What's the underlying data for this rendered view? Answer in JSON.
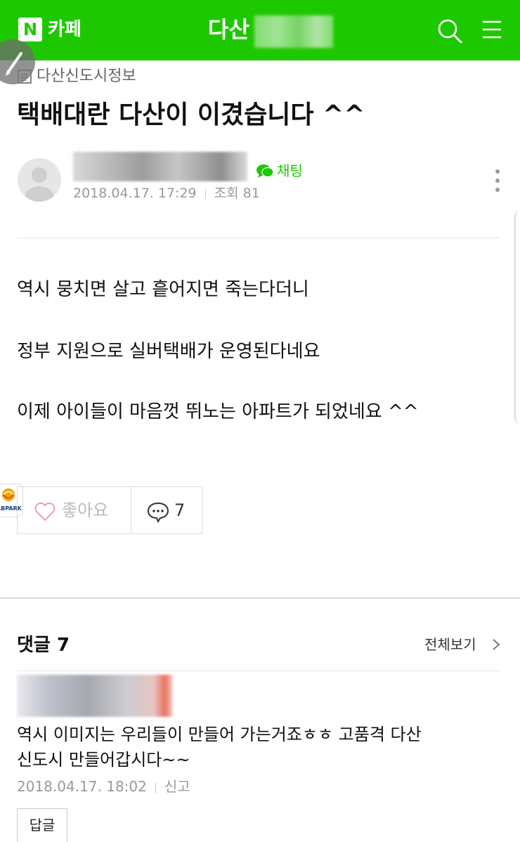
{
  "header": {
    "logo_letter": "N",
    "brand_label": "카페",
    "cafe_name_visible": "다산",
    "brand_color": "#1ec800"
  },
  "post": {
    "board_name": "다산신도시정보",
    "title": "택배대란 다산이 이겼습니다 ^^",
    "chat_label": "채팅",
    "date": "2018.04.17. 17:29",
    "views_label": "조회 81",
    "body": [
      "역시 뭉치면 살고 흩어지면 죽는다더니",
      "정부 지원으로 실버택배가 운영된다네요",
      "이제 아이들이 마음껏 뛰노는 아파트가 되었네요 ^^"
    ],
    "like_label": "좋아요",
    "comment_count": "7"
  },
  "ad_badge": {
    "text": "LBPARK"
  },
  "comments": {
    "title": "댓글 7",
    "view_all_label": "전체보기",
    "items": [
      {
        "text_lines": [
          "역시 이미지는 우리들이 만들어 가는거죠ㅎㅎ 고품격 다산",
          "신도시 만들어갑시다~~"
        ],
        "date": "2018.04.17. 18:02",
        "report_label": "신고",
        "reply_label": "답글"
      }
    ]
  },
  "icons": {
    "search": "search-icon",
    "menu": "hamburger-menu-icon",
    "board": "list-icon",
    "chat": "chat-bubble-icon",
    "more": "more-vertical-icon",
    "like": "heart-icon",
    "comment": "comment-icon",
    "chevron": "chevron-right-icon",
    "pencil": "pencil-icon"
  }
}
